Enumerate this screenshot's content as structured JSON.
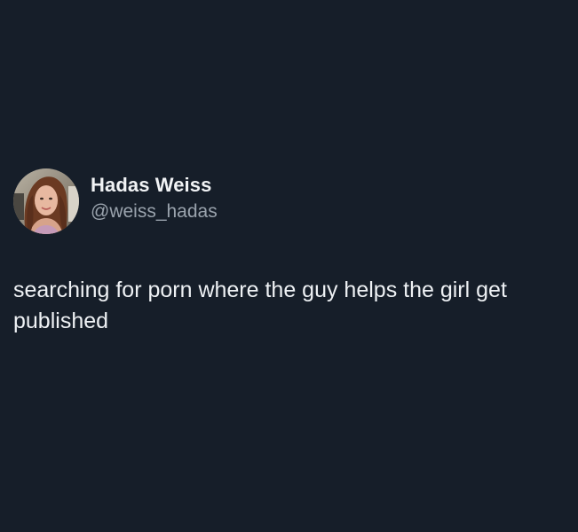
{
  "author": {
    "display_name": "Hadas Weiss",
    "handle": "@weiss_hadas"
  },
  "tweet": {
    "text": "searching for porn where the guy helps the girl get published"
  },
  "colors": {
    "background": "#161e29",
    "primary_text": "#f1f3f5",
    "secondary_text": "#9aa3ad"
  },
  "icons": {
    "avatar": "profile-photo"
  }
}
